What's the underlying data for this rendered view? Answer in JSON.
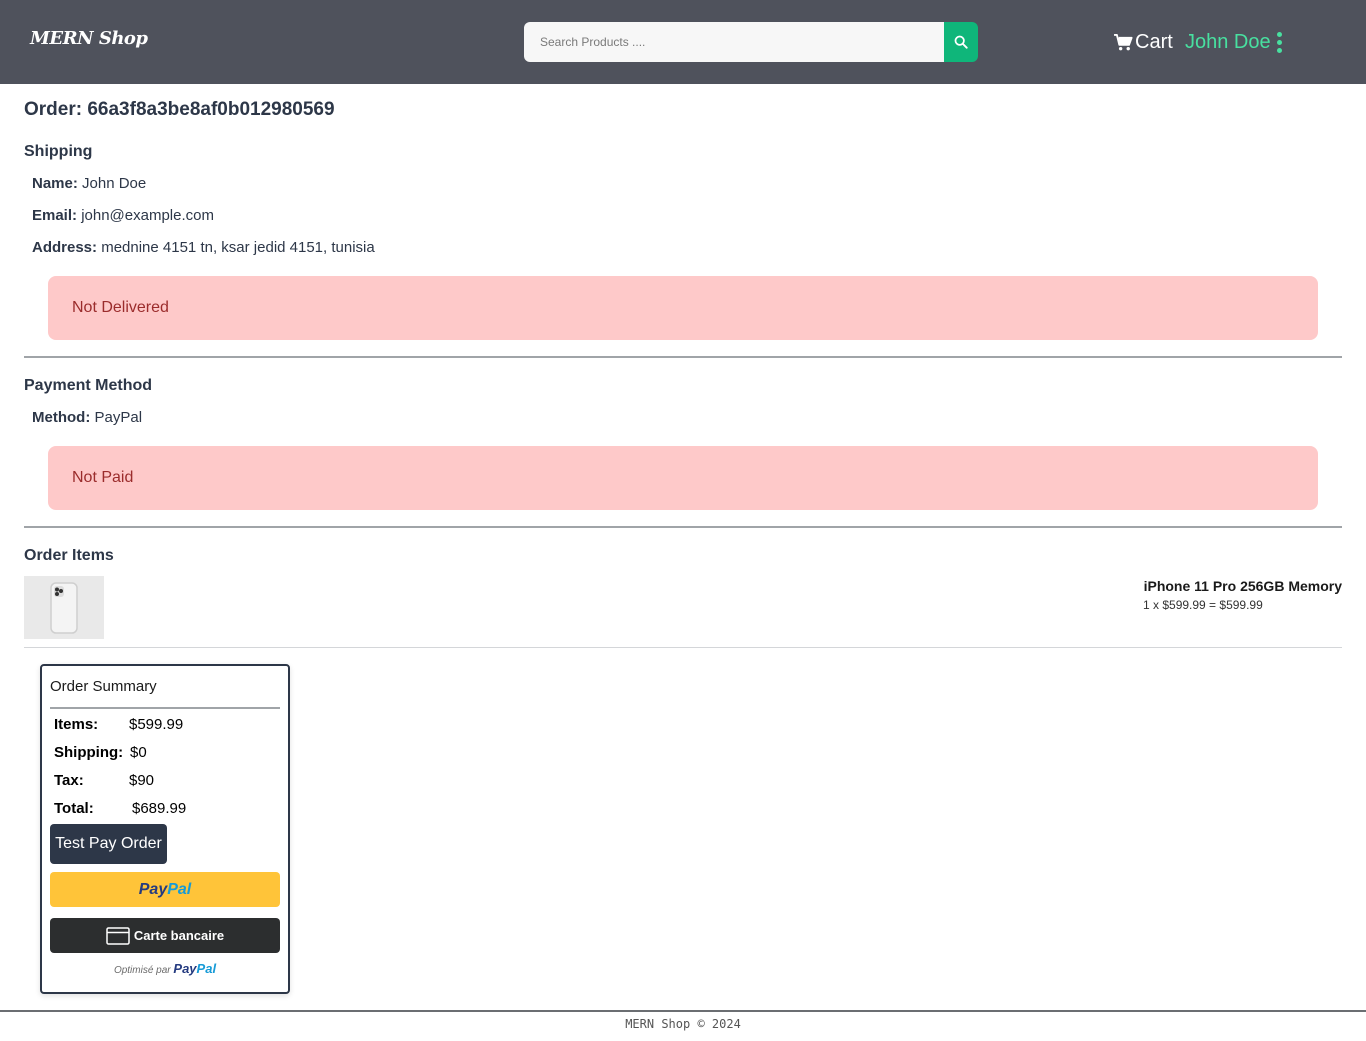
{
  "header": {
    "logo": "MERN Shop",
    "search_placeholder": "Search Products ....",
    "cart_label": "Cart",
    "user_name": "John Doe"
  },
  "order": {
    "title": "Order: 66a3f8a3be8af0b012980569"
  },
  "shipping": {
    "heading": "Shipping",
    "name_label": "Name:",
    "name_value": "John Doe",
    "email_label": "Email:",
    "email_value": "john@example.com",
    "address_label": "Address:",
    "address_value": "mednine 4151 tn, ksar jedid 4151, tunisia",
    "status": "Not Delivered"
  },
  "payment": {
    "heading": "Payment Method",
    "method_label": "Method:",
    "method_value": "PayPal",
    "status": "Not Paid"
  },
  "items": {
    "heading": "Order Items",
    "list": [
      {
        "name": "iPhone 11 Pro 256GB Memory",
        "calc": "1 x $599.99 = $599.99"
      }
    ]
  },
  "summary": {
    "title": "Order Summary",
    "items_label": "Items:",
    "items_value": "$599.99",
    "shipping_label": "Shipping:",
    "shipping_value": "$0",
    "tax_label": "Tax:",
    "tax_value": "$90",
    "total_label": "Total:",
    "total_value": "$689.99",
    "test_pay_label": "Test Pay Order",
    "paypal_pay": "Pay",
    "paypal_pal": "Pal",
    "card_label": "Carte bancaire",
    "powered_text": "Optimisé par",
    "powered_pay": "Pay",
    "powered_pal": "Pal"
  },
  "footer": {
    "text": "MERN Shop © 2024"
  },
  "colors": {
    "header_bg": "#4f525c",
    "accent_green": "#0fb67a",
    "user_green": "#48e0a0",
    "alert_bg": "#fec9c9",
    "alert_text": "#9b2c2c",
    "primary_dark": "#2d3748",
    "paypal_yellow": "#ffc439"
  },
  "icons": [
    "search-icon",
    "cart-icon",
    "kebab-menu-icon",
    "credit-card-icon"
  ]
}
